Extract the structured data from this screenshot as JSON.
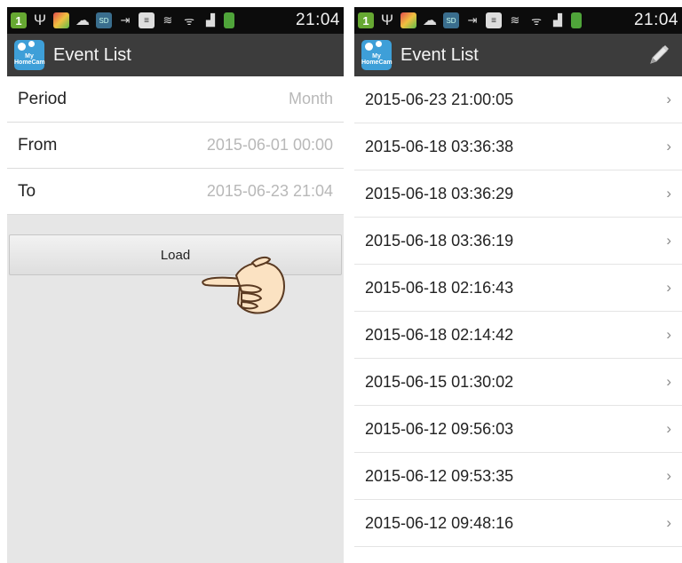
{
  "colors": {
    "status_bar": "#0c0c0c",
    "action_bar": "#3c3c3c",
    "app_logo": "#3e9fd8",
    "form_background": "#e6e6e6",
    "value_text": "#b8b8b8"
  },
  "status_bar": {
    "time": "21:04",
    "notification_badge": "1",
    "icons": [
      "notification-count-icon",
      "usb-icon",
      "app-notification-icon",
      "weather-icon",
      "sd-card-icon",
      "sync-icon",
      "document-icon",
      "vibrate-icon",
      "wifi-icon",
      "signal-icon",
      "battery-icon"
    ]
  },
  "left_screen": {
    "title": "Event List",
    "logo_text": "My HomeCam",
    "form": [
      {
        "label": "Period",
        "value": "Month"
      },
      {
        "label": "From",
        "value": "2015-06-01 00:00"
      },
      {
        "label": "To",
        "value": "2015-06-23 21:04"
      }
    ],
    "load_label": "Load"
  },
  "right_screen": {
    "title": "Event List",
    "logo_text": "My HomeCam",
    "edit_icon": "pencil-icon",
    "events": [
      "2015-06-23 21:00:05",
      "2015-06-18 03:36:38",
      "2015-06-18 03:36:29",
      "2015-06-18 03:36:19",
      "2015-06-18 02:16:43",
      "2015-06-18 02:14:42",
      "2015-06-15 01:30:02",
      "2015-06-12 09:56:03",
      "2015-06-12 09:53:35",
      "2015-06-12 09:48:16"
    ],
    "chevron": "›"
  }
}
